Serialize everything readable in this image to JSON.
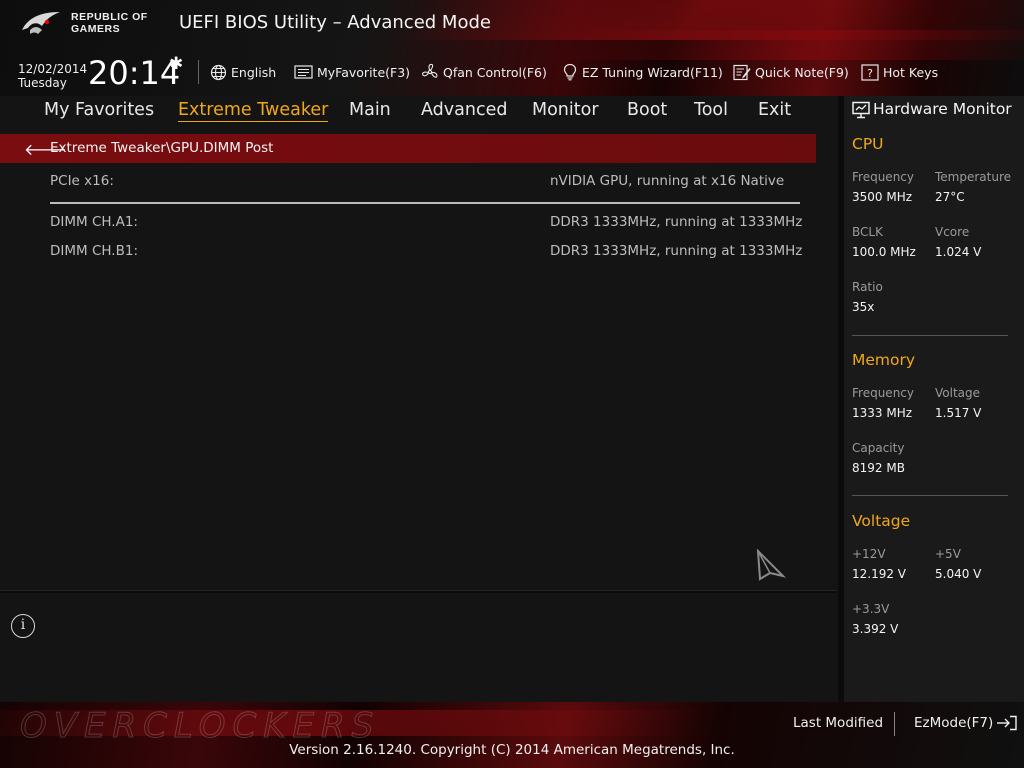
{
  "header": {
    "brand_line1": "REPUBLIC OF",
    "brand_line2": "GAMERS",
    "title": "UEFI BIOS Utility – Advanced Mode",
    "date": "12/02/2014",
    "weekday": "Tuesday",
    "time": "20:14"
  },
  "toolbar": {
    "language": "English",
    "favorite": "MyFavorite(F3)",
    "qfan": "Qfan Control(F6)",
    "ez_tuning": "EZ Tuning Wizard(F11)",
    "quick_note": "Quick Note(F9)",
    "hot_keys": "Hot Keys"
  },
  "nav": {
    "items": [
      "My Favorites",
      "Extreme Tweaker",
      "Main",
      "Advanced",
      "Monitor",
      "Boot",
      "Tool",
      "Exit"
    ],
    "active": "Extreme Tweaker"
  },
  "breadcrumb": "Extreme Tweaker\\GPU.DIMM Post",
  "rows": [
    {
      "label": "PCIe x16:",
      "value": "nVIDIA GPU, running at x16 Native"
    },
    {
      "label": "DIMM CH.A1:",
      "value": "DDR3 1333MHz, running at 1333MHz"
    },
    {
      "label": "DIMM CH.B1:",
      "value": "DDR3 1333MHz, running at 1333MHz"
    }
  ],
  "info_icon": "i",
  "hardware_monitor": {
    "title": "Hardware Monitor",
    "cpu": {
      "heading": "CPU",
      "frequency_label": "Frequency",
      "frequency": "3500 MHz",
      "temperature_label": "Temperature",
      "temperature": "27°C",
      "bclk_label": "BCLK",
      "bclk": "100.0 MHz",
      "vcore_label": "Vcore",
      "vcore": "1.024 V",
      "ratio_label": "Ratio",
      "ratio": "35x"
    },
    "memory": {
      "heading": "Memory",
      "frequency_label": "Frequency",
      "frequency": "1333 MHz",
      "voltage_label": "Voltage",
      "voltage": "1.517 V",
      "capacity_label": "Capacity",
      "capacity": "8192 MB"
    },
    "voltage": {
      "heading": "Voltage",
      "v12_label": "+12V",
      "v12": "12.192 V",
      "v5_label": "+5V",
      "v5": "5.040 V",
      "v33_label": "+3.3V",
      "v33": "3.392 V"
    }
  },
  "footer": {
    "last_modified": "Last Modified",
    "ez_mode": "EzMode(F7)",
    "copyright": "Version 2.16.1240. Copyright (C) 2014 American Megatrends, Inc."
  },
  "colors": {
    "accent": "#f0a81a",
    "breadcrumb_bg": "#6a0d0f",
    "sidebar_bg": "#1a1a1a"
  }
}
